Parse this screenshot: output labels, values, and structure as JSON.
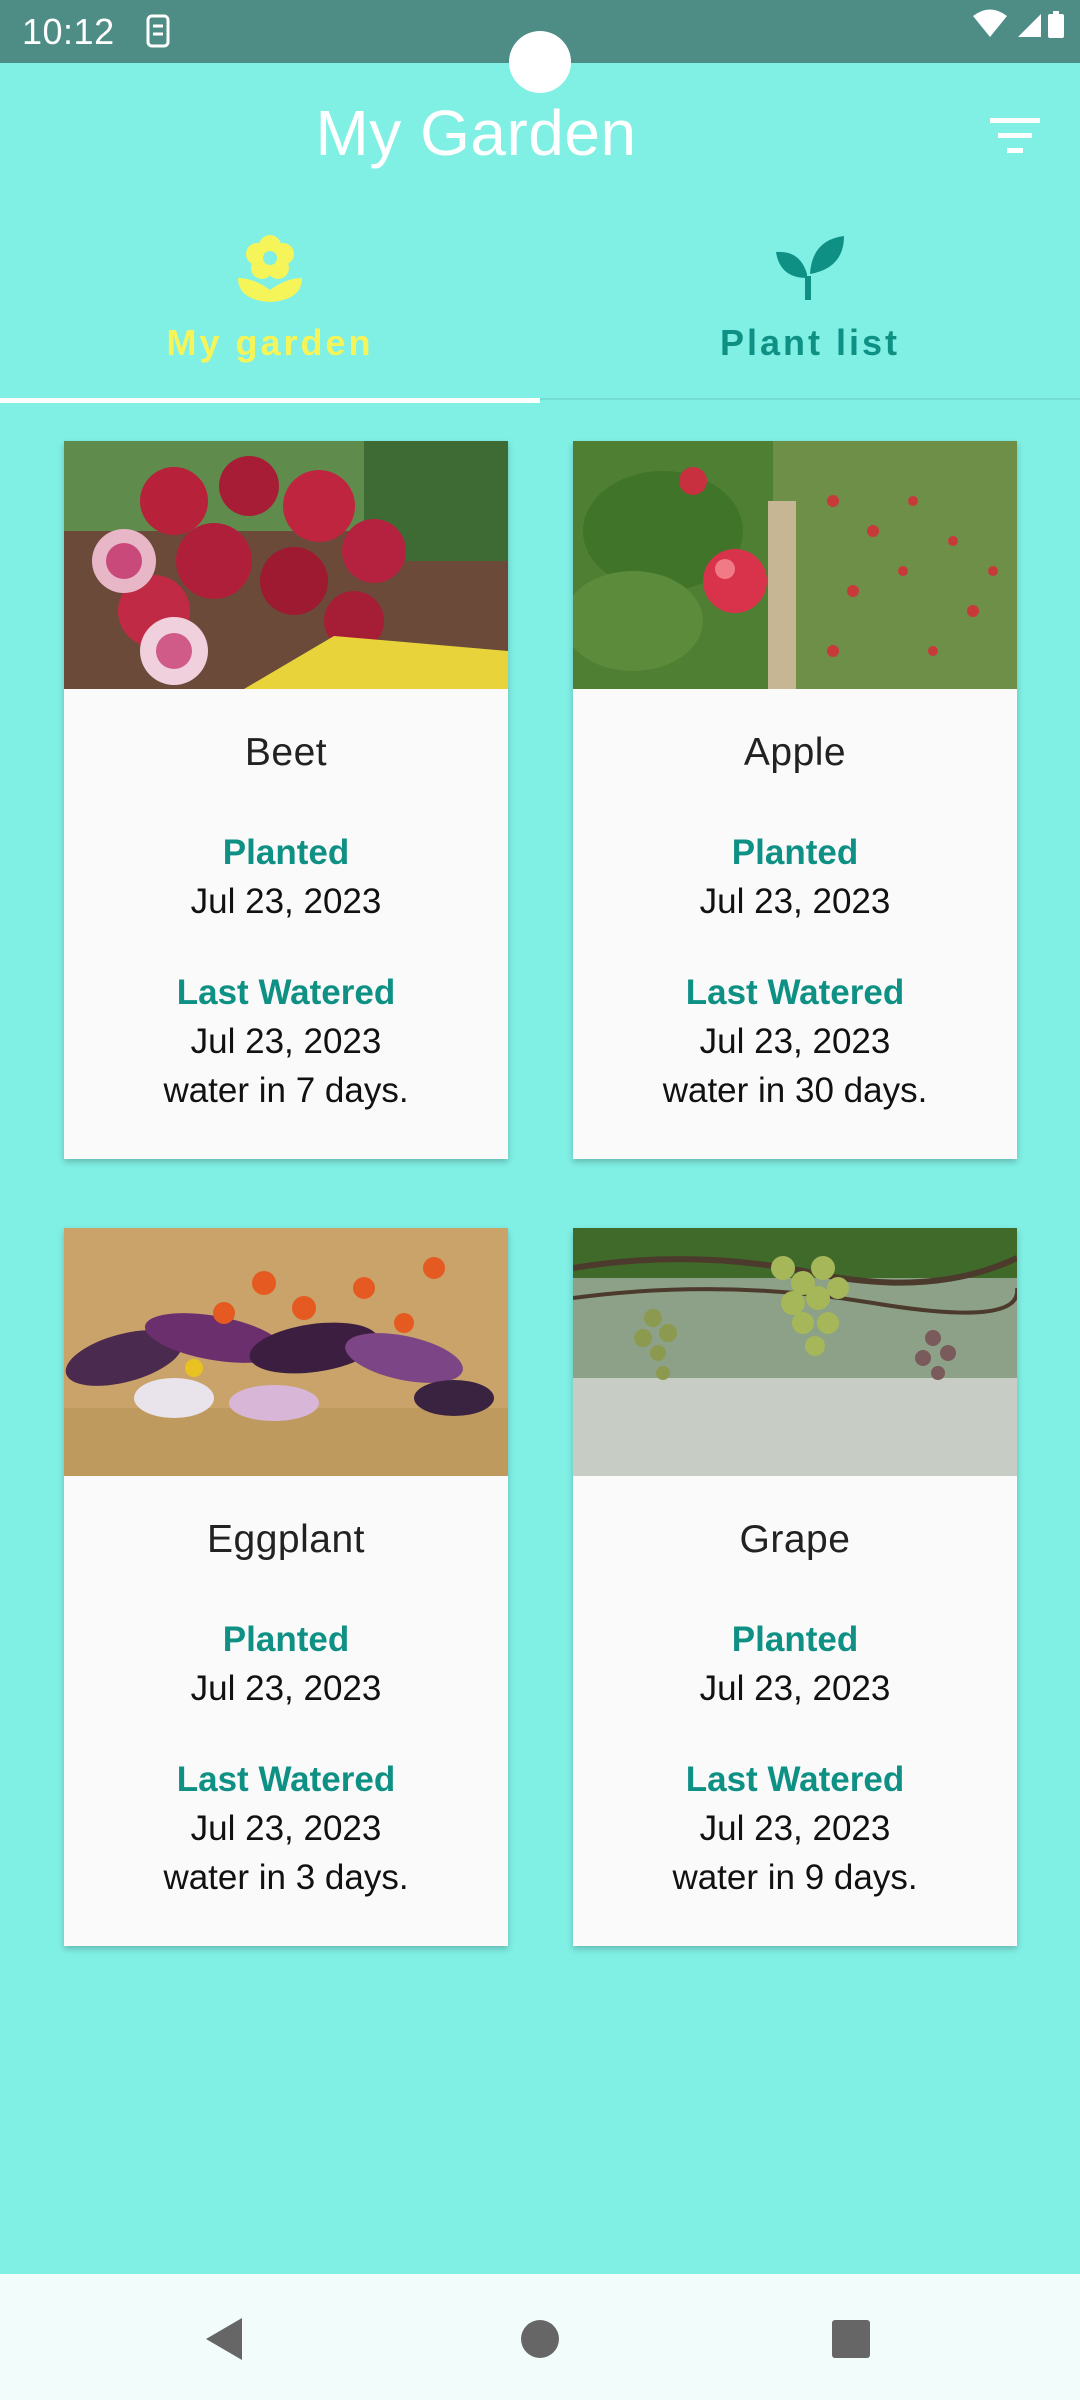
{
  "status_bar": {
    "time": "10:12",
    "icons": [
      "sim-card-icon",
      "wifi-icon",
      "signal-icon",
      "battery-icon"
    ]
  },
  "app_bar": {
    "title": "My Garden",
    "filter_icon": "filter-list-icon"
  },
  "tabs": [
    {
      "label": "My garden",
      "icon": "flower-icon",
      "selected": true,
      "color": "#F5F55A"
    },
    {
      "label": "Plant list",
      "icon": "sprout-icon",
      "selected": false,
      "color": "#0E9184"
    }
  ],
  "plants": [
    {
      "name": "Beet",
      "planted_label": "Planted",
      "planted_date": "Jul 23, 2023",
      "watered_label": "Last Watered",
      "watered_date": "Jul 23, 2023",
      "water_in": "water in 7 days.",
      "image": "beets-photo"
    },
    {
      "name": "Apple",
      "planted_label": "Planted",
      "planted_date": "Jul 23, 2023",
      "watered_label": "Last Watered",
      "watered_date": "Jul 23, 2023",
      "water_in": "water in 30 days.",
      "image": "apple-tree-photo"
    },
    {
      "name": "Eggplant",
      "planted_label": "Planted",
      "planted_date": "Jul 23, 2023",
      "watered_label": "Last Watered",
      "watered_date": "Jul 23, 2023",
      "water_in": "water in 3 days.",
      "image": "eggplants-photo"
    },
    {
      "name": "Grape",
      "planted_label": "Planted",
      "planted_date": "Jul 23, 2023",
      "watered_label": "Last Watered",
      "watered_date": "Jul 23, 2023",
      "water_in": "water in 9 days.",
      "image": "grapes-photo"
    }
  ],
  "nav": {
    "back_icon": "back-triangle-icon",
    "home_icon": "home-circle-icon",
    "recents_icon": "recents-square-icon"
  },
  "colors": {
    "background": "#80EFE4",
    "status_bar": "#4E8C86",
    "accent": "#0E9184",
    "selected_tab": "#F5F55A",
    "card": "#FAFAFA"
  }
}
